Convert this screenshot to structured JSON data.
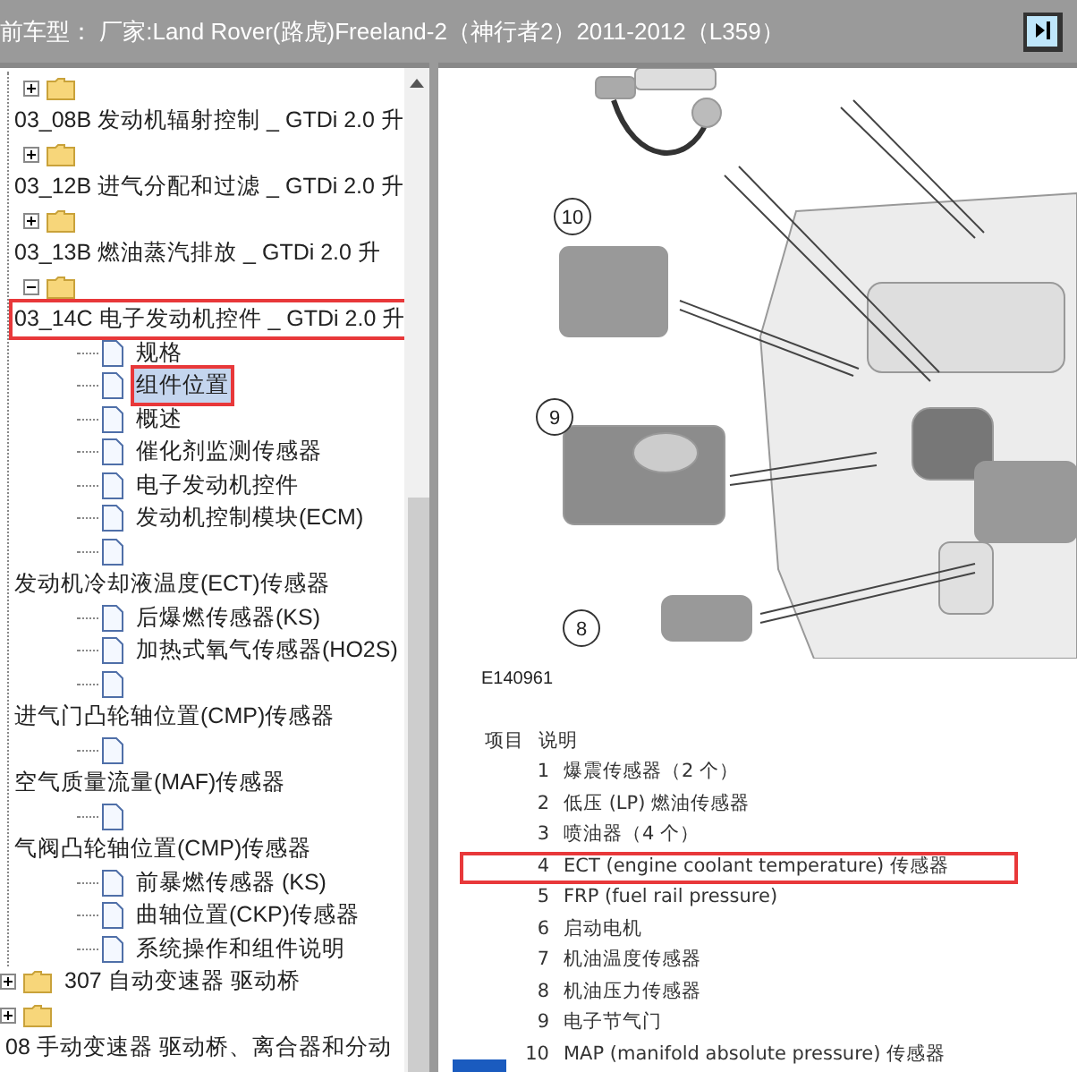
{
  "header": {
    "title": "前车型： 厂家:Land Rover(路虎)Freeland-2（神行者2）2011-2012（L359）"
  },
  "tree": [
    {
      "children": [
        {
          "kind": "folder",
          "label": "03_08B 发动机辐射控制 _ GTDi 2.0 升",
          "expanded": false,
          "label_below": true,
          "selected": false,
          "annotated": false
        },
        {
          "kind": "folder",
          "label": "03_12B 进气分配和过滤 _ GTDi 2.0 升",
          "expanded": false,
          "label_below": true,
          "selected": false,
          "annotated": false
        },
        {
          "kind": "folder",
          "label": "03_13B 燃油蒸汽排放 _ GTDi 2.0 升",
          "expanded": false,
          "label_below": true,
          "selected": false,
          "annotated": false
        },
        {
          "kind": "folder",
          "label": "03_14C 电子发动机控件 _ GTDi 2.0 升",
          "expanded": true,
          "label_below": true,
          "selected": false,
          "annotated": true,
          "children": [
            {
              "kind": "page",
              "label": "规格",
              "label_below": false,
              "selected": false,
              "annotated": false
            },
            {
              "kind": "page",
              "label": "组件位置",
              "label_below": false,
              "selected": true,
              "annotated": true
            },
            {
              "kind": "page",
              "label": "概述",
              "label_below": false,
              "selected": false,
              "annotated": false
            },
            {
              "kind": "page",
              "label": "催化剂监测传感器",
              "label_below": false,
              "selected": false,
              "annotated": false
            },
            {
              "kind": "page",
              "label": "电子发动机控件",
              "label_below": false,
              "selected": false,
              "annotated": false
            },
            {
              "kind": "page",
              "label": "发动机控制模块(ECM)",
              "label_below": false,
              "selected": false,
              "annotated": false
            },
            {
              "kind": "page",
              "label": "发动机冷却液温度(ECT)传感器",
              "label_below": true,
              "selected": false,
              "annotated": false
            },
            {
              "kind": "page",
              "label": "后爆燃传感器(KS)",
              "label_below": false,
              "selected": false,
              "annotated": false
            },
            {
              "kind": "page",
              "label": "加热式氧气传感器(HO2S)",
              "label_below": false,
              "selected": false,
              "annotated": false
            },
            {
              "kind": "page",
              "label": "进气门凸轮轴位置(CMP)传感器",
              "label_below": true,
              "selected": false,
              "annotated": false
            },
            {
              "kind": "page",
              "label": "空气质量流量(MAF)传感器",
              "label_below": true,
              "selected": false,
              "annotated": false
            },
            {
              "kind": "page",
              "label": "气阀凸轮轴位置(CMP)传感器",
              "label_below": true,
              "selected": false,
              "annotated": false
            },
            {
              "kind": "page",
              "label": "前暴燃传感器 (KS)",
              "label_below": false,
              "selected": false,
              "annotated": false
            },
            {
              "kind": "page",
              "label": "曲轴位置(CKP)传感器",
              "label_below": false,
              "selected": false,
              "annotated": false
            },
            {
              "kind": "page",
              "label": "系统操作和组件说明",
              "label_below": false,
              "selected": false,
              "annotated": false
            }
          ]
        }
      ]
    },
    {
      "kind": "folder",
      "label": "307 自动变速器 驱动桥",
      "expanded": false,
      "label_below": false,
      "selected": false,
      "annotated": false
    },
    {
      "kind": "folder",
      "label": "08 手动变速器 驱动桥、离合器和分动",
      "expanded": false,
      "label_below": true,
      "selected": false,
      "annotated": false
    }
  ],
  "figure": {
    "callouts": [
      "10",
      "9",
      "8"
    ],
    "code": "E140961"
  },
  "legend": {
    "columns": [
      "项目",
      "说明"
    ],
    "rows": [
      {
        "item": "1",
        "text": "爆震传感器（2 个）",
        "annotated": false
      },
      {
        "item": "2",
        "text": "低压 (LP) 燃油传感器",
        "annotated": false
      },
      {
        "item": "3",
        "text": "喷油器（4 个）",
        "annotated": false
      },
      {
        "item": "4",
        "text": "ECT (engine coolant temperature) 传感器",
        "annotated": true
      },
      {
        "item": "5",
        "text": "FRP (fuel rail pressure)",
        "annotated": false
      },
      {
        "item": "6",
        "text": "启动电机",
        "annotated": false
      },
      {
        "item": "7",
        "text": "机油温度传感器",
        "annotated": false
      },
      {
        "item": "8",
        "text": "机油压力传感器",
        "annotated": false
      },
      {
        "item": "9",
        "text": "电子节气门",
        "annotated": false
      },
      {
        "item": "10",
        "text": "MAP (manifold absolute pressure) 传感器",
        "annotated": false
      }
    ]
  }
}
